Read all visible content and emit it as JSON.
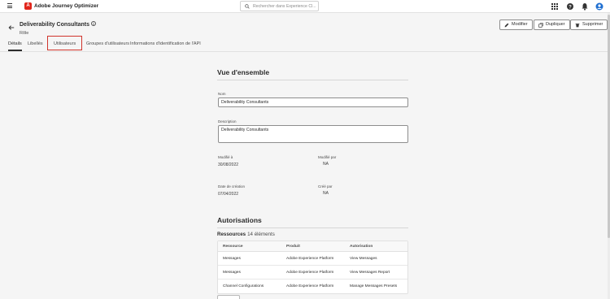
{
  "topbar": {
    "app_name": "Adobe Journey Optimizer",
    "logo_letter": "A",
    "search_placeholder": "Rechercher dans Experience Cl...",
    "icons": [
      "menu-icon",
      "adobe-logo-icon",
      "search-icon",
      "apps-grid-icon",
      "help-icon",
      "notifications-icon",
      "user-avatar-icon"
    ],
    "brand_color": "#e1251b"
  },
  "header": {
    "title": "Deliverability Consultants",
    "subtitle": "Rôle",
    "buttons": {
      "edit": "Modifier",
      "duplicate": "Dupliquer",
      "delete": "Supprimer"
    }
  },
  "tabs": [
    {
      "label": "Détails",
      "active": true
    },
    {
      "label": "Libellés",
      "active": false
    },
    {
      "label": "Utilisateurs",
      "active": false,
      "highlighted": true
    },
    {
      "label": "Groupes d'utilisateurs",
      "active": false
    },
    {
      "label": "Informations d'identification de l'API",
      "active": false
    }
  ],
  "overview": {
    "title": "Vue d'ensemble",
    "name_label": "Nom",
    "name_value": "Deliverability Consultants",
    "description_label": "Description",
    "description_value": "Deliverability Consultants",
    "modified_on_label": "Modifié à",
    "modified_on_value": "30/08/2022",
    "modified_by_label": "Modifié par",
    "modified_by_value": "NA",
    "created_on_label": "Date de création",
    "created_on_value": "07/04/2022",
    "created_by_label": "Créé par",
    "created_by_value": "NA"
  },
  "permissions": {
    "title": "Autorisations",
    "resources_label": "Ressources",
    "resources_count": "14 éléments",
    "columns": [
      "Ressource",
      "Produit",
      "Autorisation"
    ],
    "rows": [
      [
        "Messages",
        "Adobe Experience Platform",
        "View Messages"
      ],
      [
        "Messages",
        "Adobe Experience Platform",
        "View Messages Report"
      ],
      [
        "Channel Configurations",
        "Adobe Experience Platform",
        "Manage Messages Presets"
      ]
    ]
  }
}
